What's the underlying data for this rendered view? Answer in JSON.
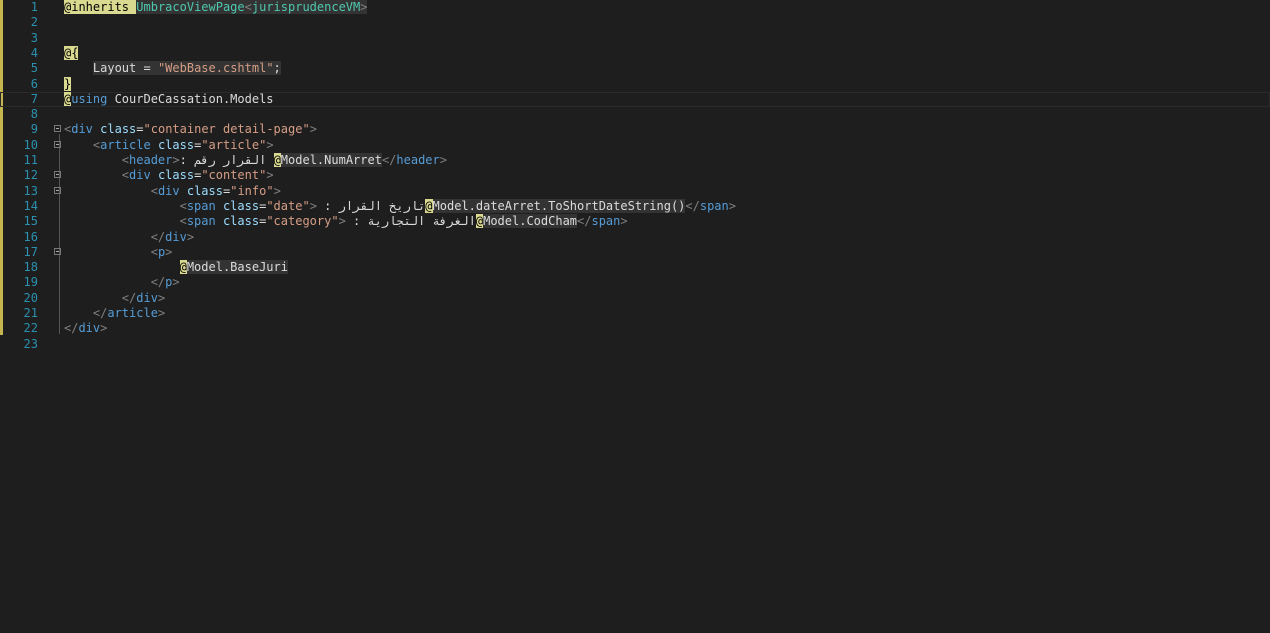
{
  "editor": {
    "line_numbers": [
      "1",
      "2",
      "3",
      "4",
      "5",
      "6",
      "7",
      "8",
      "9",
      "10",
      "11",
      "12",
      "13",
      "14",
      "15",
      "16",
      "17",
      "18",
      "19",
      "20",
      "21",
      "22",
      "23"
    ],
    "l1": {
      "at": "@",
      "kw": "inherits",
      "type1": "UmbracoViewPage",
      "lt": "<",
      "type2": "jurisprudenceVM",
      "gt": ">"
    },
    "l4": {
      "at": "@",
      "brace": "{"
    },
    "l5": {
      "indent": "    ",
      "name": "Layout",
      "eq": " = ",
      "str": "\"WebBase.cshtml\"",
      "semi": ";"
    },
    "l6": {
      "brace": "}"
    },
    "l7": {
      "at": "@",
      "kw": "using",
      "ns": " CourDeCassation.Models"
    },
    "l9": {
      "open": "<",
      "tag": "div",
      "attr": " class",
      "eq": "=",
      "val": "\"container detail-page\"",
      "close": ">"
    },
    "l10": {
      "indent": "    ",
      "open": "<",
      "tag": "article",
      "attr": " class",
      "eq": "=",
      "val": "\"article\"",
      "close": ">"
    },
    "l11": {
      "indent": "        ",
      "open": "<",
      "tag": "header",
      "close": ">",
      "text": "القرار رقم :",
      "at": "@",
      "expr": "Model.NumArret",
      "endopen": "</",
      "endtag": "header",
      "endclose": ">"
    },
    "l12": {
      "indent": "        ",
      "open": "<",
      "tag": "div",
      "attr": " class",
      "eq": "=",
      "val": "\"content\"",
      "close": ">"
    },
    "l13": {
      "indent": "            ",
      "open": "<",
      "tag": "div",
      "attr": " class",
      "eq": "=",
      "val": "\"info\"",
      "close": ">"
    },
    "l14": {
      "indent": "                ",
      "open": "<",
      "tag": "span",
      "attr": " class",
      "eq": "=",
      "val": "\"date\"",
      "close": ">",
      "text": "تاريخ القرار : ",
      "at": "@",
      "expr": "Model.dateArret.ToShortDateString()",
      "endopen": "</",
      "endtag": "span",
      "endclose": ">"
    },
    "l15": {
      "indent": "                ",
      "open": "<",
      "tag": "span",
      "attr": " class",
      "eq": "=",
      "val": "\"category\"",
      "close": ">",
      "text": "الغرفة التجارية : ",
      "at": "@",
      "expr": "Model.CodCham",
      "endopen": "</",
      "endtag": "span",
      "endclose": ">"
    },
    "l16": {
      "indent": "            ",
      "open": "</",
      "tag": "div",
      "close": ">"
    },
    "l17": {
      "indent": "            ",
      "open": "<",
      "tag": "p",
      "close": ">"
    },
    "l18": {
      "indent": "                ",
      "at": "@",
      "expr": "Model.BaseJuri"
    },
    "l19": {
      "indent": "            ",
      "open": "</",
      "tag": "p",
      "close": ">"
    },
    "l20": {
      "indent": "        ",
      "open": "</",
      "tag": "div",
      "close": ">"
    },
    "l21": {
      "indent": "    ",
      "open": "</",
      "tag": "article",
      "close": ">"
    },
    "l22": {
      "open": "</",
      "tag": "div",
      "close": ">"
    }
  }
}
